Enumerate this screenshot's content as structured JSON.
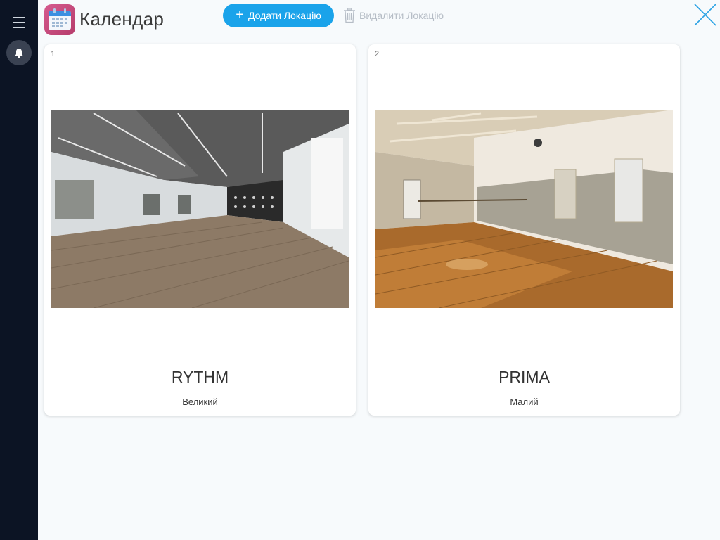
{
  "app": {
    "title": "Календар",
    "icon": "calendar-icon",
    "accent": "#1aa3ea"
  },
  "sidebar": {
    "menu_icon": "hamburger-icon",
    "notification_icon": "bell-icon"
  },
  "toolbar": {
    "add_label": "Додати Локацію",
    "delete_label": "Видалити Локацію",
    "close_icon": "close-icon"
  },
  "locations": [
    {
      "number": "1",
      "name": "RYTHM",
      "size": "Великий",
      "image": "dance-studio-photo"
    },
    {
      "number": "2",
      "name": "PRIMA",
      "size": "Малий",
      "image": "ballet-studio-photo"
    }
  ]
}
